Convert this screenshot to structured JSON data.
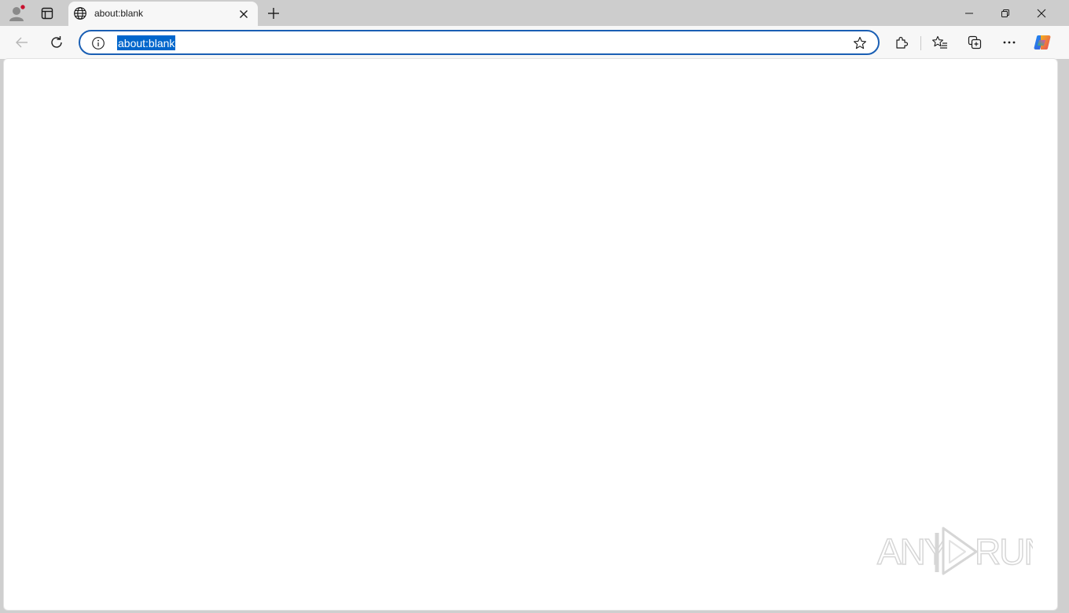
{
  "browser": {
    "tab": {
      "title": "about:blank"
    },
    "address_bar": {
      "url": "about:blank"
    },
    "colors": {
      "accent": "#1a5fb4",
      "selection": "#0066cc",
      "chrome": "#cdcdcd",
      "toolbar": "#f7f7f7"
    },
    "icons": [
      "profile-icon",
      "workspaces-icon",
      "globe-icon",
      "close-icon",
      "plus-icon",
      "minimize-icon",
      "restore-icon",
      "window-close-icon",
      "back-arrow-icon",
      "reload-icon",
      "info-icon",
      "star-icon",
      "extensions-icon",
      "favorites-icon",
      "collections-icon",
      "more-icon",
      "copilot-icon"
    ]
  },
  "watermark": {
    "text_left": "ANY",
    "text_right": "RUN"
  }
}
